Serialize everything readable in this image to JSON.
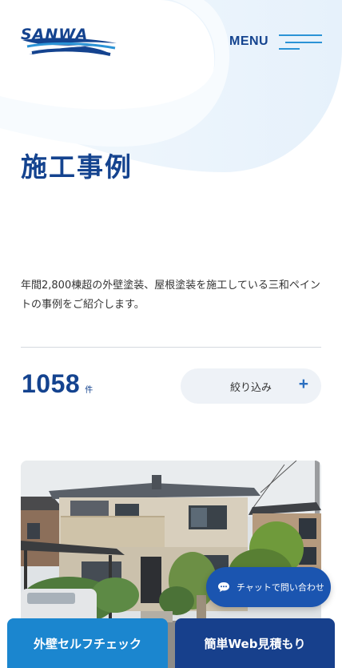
{
  "header": {
    "logo_text": "SANWA",
    "menu_label": "MENU"
  },
  "page": {
    "title": "施工事例",
    "intro": "年間2,800棟超の外壁塗装、屋根塗装を施工している三和ペイントの事例をご紹介します。"
  },
  "results": {
    "count": "1058",
    "unit": "件",
    "filter_label": "絞り込み",
    "filter_icon": "+"
  },
  "chat": {
    "label": "チャットで問い合わせ",
    "icon": "chat-bubble-icon"
  },
  "bottom_bar": {
    "self_check_label": "外壁セルフチェック",
    "estimate_label": "簡単Web見積もり"
  },
  "colors": {
    "brand_navy": "#14438f",
    "accent_blue": "#2b93d6",
    "cta_light": "#1b86cf",
    "cta_dark": "#17408c"
  }
}
